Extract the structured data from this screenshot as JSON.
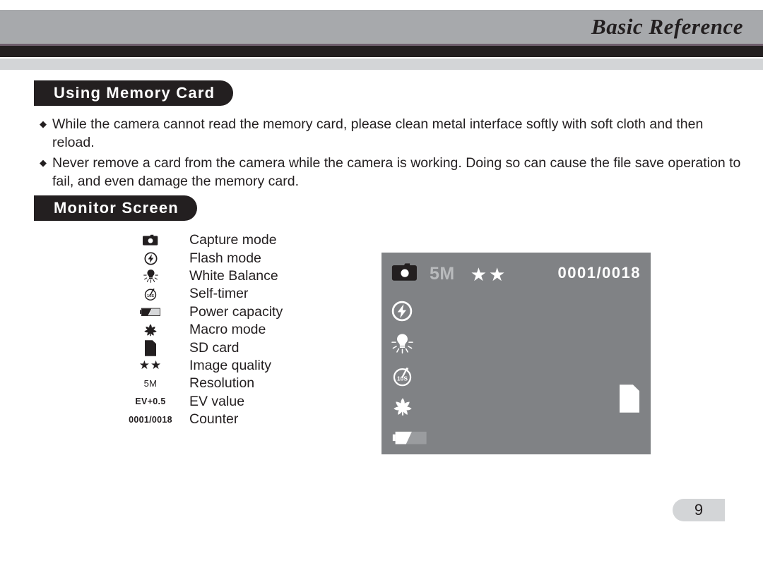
{
  "header": {
    "title": "Basic Reference"
  },
  "sections": {
    "memory_card": {
      "heading": "Using Memory Card",
      "bullet_mark": "◆",
      "bullets": [
        "While the camera cannot read the memory card, please clean metal interface softly with soft cloth and then reload.",
        "Never remove a card from the camera while the camera is working. Doing so can cause the file save operation to fail, and even damage the memory card."
      ]
    },
    "monitor_screen": {
      "heading": "Monitor Screen",
      "legend": [
        {
          "icon": "camera-icon",
          "glyph_type": "svg",
          "glyph": "",
          "label": "Capture mode"
        },
        {
          "icon": "flash-icon",
          "glyph_type": "svg",
          "glyph": "",
          "label": "Flash mode"
        },
        {
          "icon": "white-balance-icon",
          "glyph_type": "svg",
          "glyph": "",
          "label": "White Balance"
        },
        {
          "icon": "self-timer-icon",
          "glyph_type": "svg",
          "glyph": "",
          "label": "Self-timer"
        },
        {
          "icon": "battery-icon",
          "glyph_type": "svg",
          "glyph": "",
          "label": "Power capacity"
        },
        {
          "icon": "macro-icon",
          "glyph_type": "svg",
          "glyph": "",
          "label": "Macro mode"
        },
        {
          "icon": "sd-card-icon",
          "glyph_type": "svg",
          "glyph": "",
          "label": "SD card"
        },
        {
          "icon": "stars-icon",
          "glyph_type": "text",
          "glyph": "★★",
          "label": "Image quality"
        },
        {
          "icon": "resolution-text",
          "glyph_type": "text",
          "glyph": "5M",
          "label": "Resolution"
        },
        {
          "icon": "ev-value-text",
          "glyph_type": "text",
          "glyph": "EV+0.5",
          "label": "EV value"
        },
        {
          "icon": "counter-text",
          "glyph_type": "text",
          "glyph": "0001/0018",
          "label": "Counter"
        }
      ]
    }
  },
  "lcd": {
    "resolution": "5M",
    "quality_stars": "★★",
    "counter": "0001/0018",
    "background_color": "#808285",
    "icon_color": "#ffffff",
    "resolution_color": "#b9bbbd",
    "self_timer_label": "10S",
    "side_icons": [
      "flash-icon",
      "white-balance-icon",
      "self-timer-icon",
      "macro-icon",
      "battery-icon"
    ],
    "corner_icon": "sd-card-icon"
  },
  "footer": {
    "page_number": "9"
  },
  "colors": {
    "header_band": "#a7a9ac",
    "dark_band": "#231f20",
    "light_band": "#d3d5d7",
    "accent_line": "#6e5e6c",
    "text": "#231f20"
  }
}
